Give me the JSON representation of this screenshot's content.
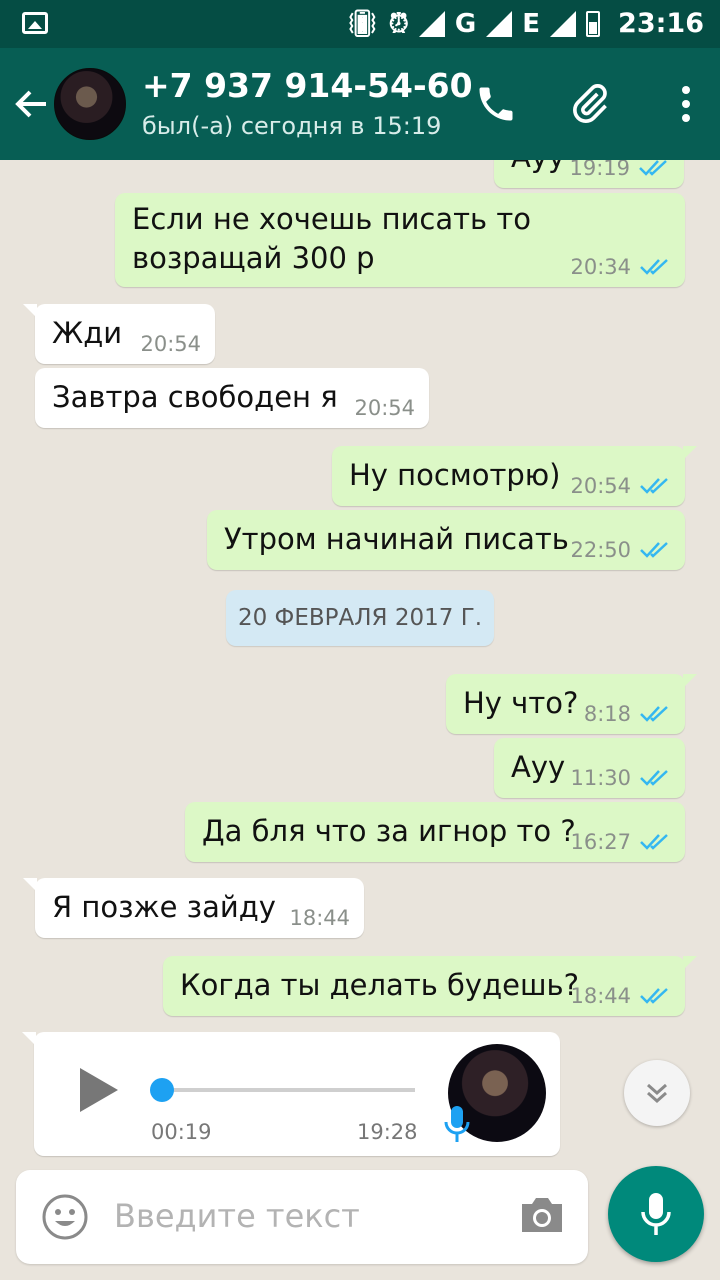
{
  "status_bar": {
    "network_labels": [
      "G",
      "E"
    ],
    "time": "23:16"
  },
  "header": {
    "contact_name": "+7 937 914-54-60",
    "last_seen": "был(-а) сегодня в 15:19"
  },
  "messages": [
    {
      "dir": "out",
      "text": "Ауу",
      "time": "19:19"
    },
    {
      "dir": "out",
      "lines": [
        "Если не хочешь писать то",
        "возращай 300 р"
      ],
      "time": "20:34"
    },
    {
      "dir": "in",
      "text": "Жди",
      "time": "20:54"
    },
    {
      "dir": "in",
      "text": "Завтра свободен я",
      "time": "20:54"
    },
    {
      "dir": "out",
      "text": "Ну посмотрю)",
      "time": "20:54"
    },
    {
      "dir": "out",
      "text": "Утром начинай писать",
      "time": "22:50"
    },
    {
      "dir": "out",
      "text": "Ну что?",
      "time": "8:18"
    },
    {
      "dir": "out",
      "text": "Ауу",
      "time": "11:30"
    },
    {
      "dir": "out",
      "text": "Да бля что за игнор то ?",
      "time": "16:27"
    },
    {
      "dir": "in",
      "text": "Я позже зайду",
      "time": "18:44"
    },
    {
      "dir": "out",
      "text": "Когда ты делать будешь?",
      "time": "18:44"
    }
  ],
  "date_separator": "20 ФЕВРАЛЯ 2017 Г.",
  "voice_message": {
    "duration": "00:19",
    "time": "19:28",
    "progress": 0
  },
  "input": {
    "placeholder": "Введите текст"
  },
  "colors": {
    "header": "#075e54",
    "status_bar": "#054d44",
    "outgoing_bubble": "#dcf8c6",
    "incoming_bubble": "#ffffff",
    "read_ticks": "#34b7f1",
    "mic_button": "#00897b"
  },
  "icons": [
    "back-arrow-icon",
    "phone-icon",
    "paperclip-icon",
    "more-vert-icon",
    "play-icon",
    "mic-icon",
    "chevron-down-icon",
    "emoji-icon",
    "camera-icon"
  ]
}
